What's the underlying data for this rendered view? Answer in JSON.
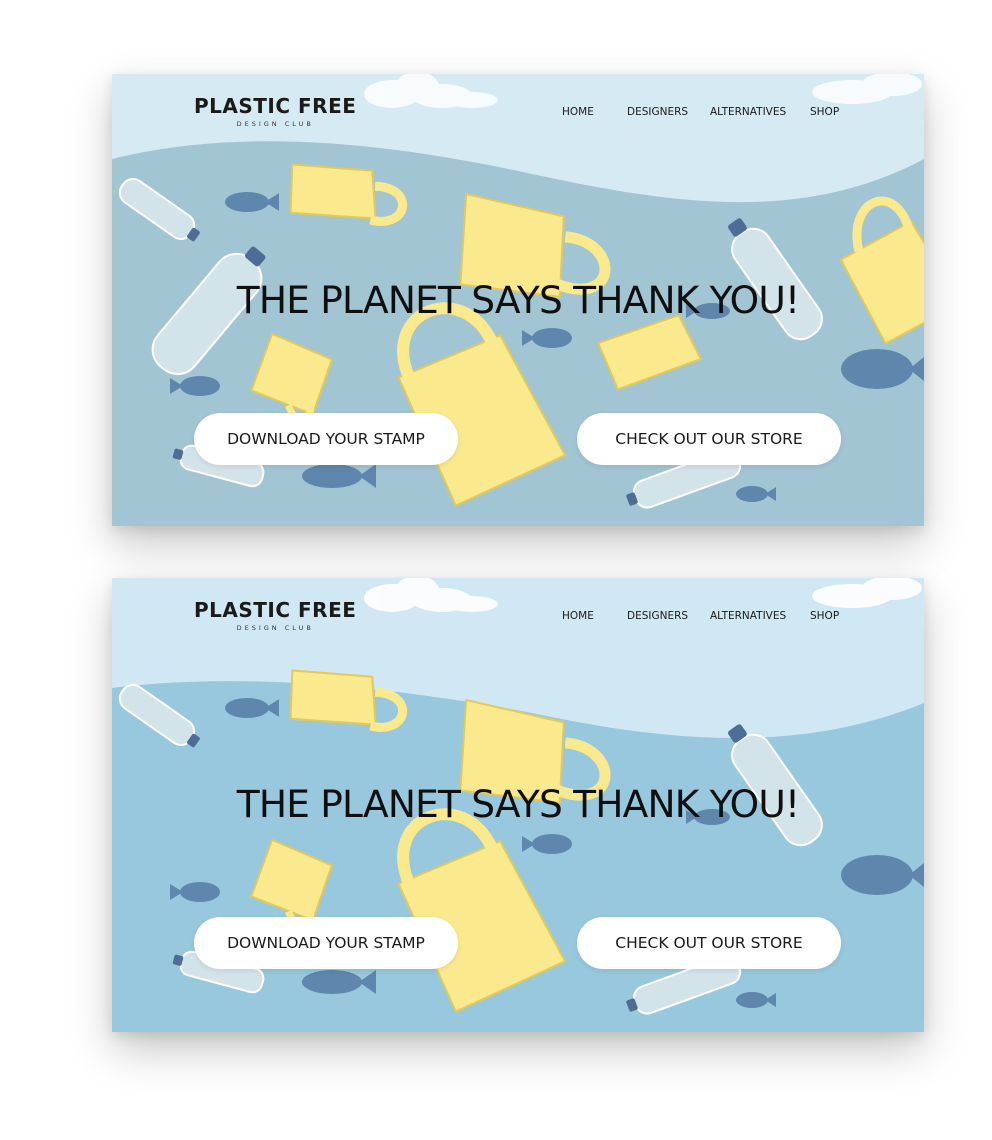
{
  "brand": {
    "title": "PLASTIC FREE",
    "subtitle": "DESIGN CLUB"
  },
  "nav": [
    {
      "label": "HOME"
    },
    {
      "label": "DESIGNERS"
    },
    {
      "label": "ALTERNATIVES"
    },
    {
      "label": "SHOP"
    }
  ],
  "hero": {
    "headline": "THE PLANET SAYS THANK YOU!"
  },
  "buttons": {
    "stamp": "DOWNLOAD YOUR STAMP",
    "store": "CHECK OUT OUR STORE"
  },
  "colors": {
    "sky": "#d6eaf3",
    "cloud": "#ffffff",
    "water_v1": "#a2c5d3",
    "water_v2": "#97c8de",
    "bag_yellow": "#fbe98e",
    "bag_stroke": "#e3c95a",
    "bottle": "#d3e3ea",
    "cap": "#4d6d96",
    "fish": "#5f86ac"
  }
}
